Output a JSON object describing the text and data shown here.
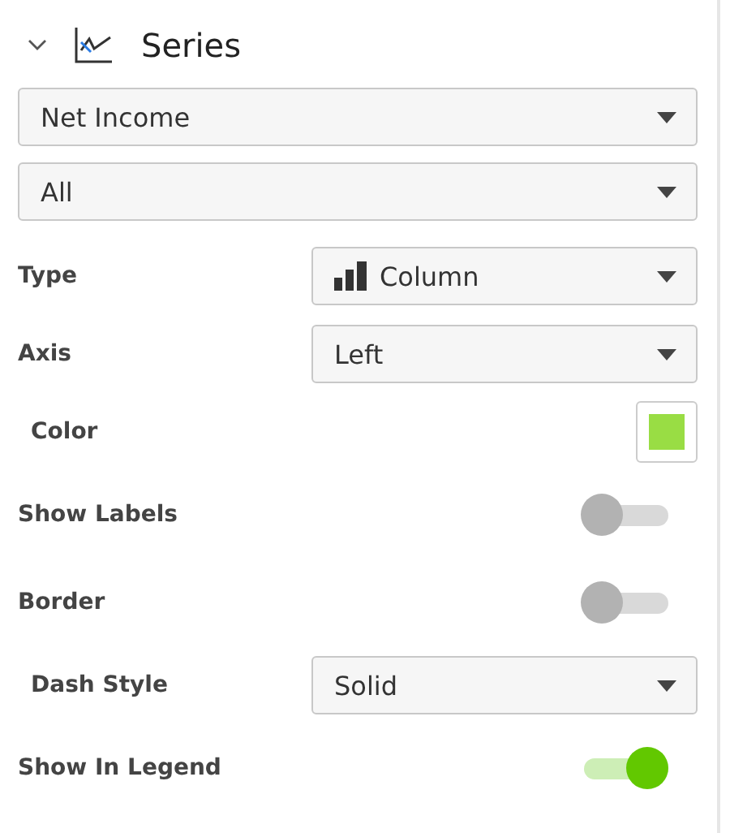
{
  "section": {
    "title": "Series",
    "expanded": true
  },
  "selects": [
    {
      "value": "Net Income"
    },
    {
      "value": "All"
    }
  ],
  "properties": [
    {
      "kind": "select",
      "label": "Type",
      "value": "Column",
      "with_icon": true,
      "indented": false
    },
    {
      "kind": "select",
      "label": "Axis",
      "value": "Left",
      "with_icon": false,
      "indented": false
    },
    {
      "kind": "color",
      "label": "Color",
      "color": "#99dd44",
      "indented": true
    },
    {
      "kind": "toggle",
      "label": "Show Labels",
      "on": false,
      "indented": false
    },
    {
      "kind": "toggle",
      "label": "Border",
      "on": false,
      "indented": false
    },
    {
      "kind": "select",
      "label": "Dash Style",
      "value": "Solid",
      "with_icon": false,
      "indented": true
    },
    {
      "kind": "toggle",
      "label": "Show In Legend",
      "on": true,
      "indented": false
    }
  ]
}
